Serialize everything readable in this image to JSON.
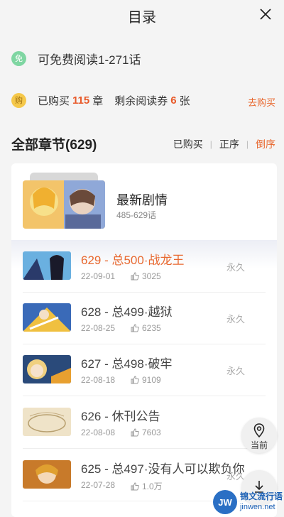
{
  "header": {
    "title": "目录"
  },
  "info": {
    "free": {
      "badge": "免",
      "text": "可免费阅读1-271话"
    },
    "purchased": {
      "badge": "购",
      "prefix": "已购买",
      "count": "115",
      "unit": "章",
      "coupon_prefix": "剩余阅读券",
      "coupon_count": "6",
      "coupon_unit": "张",
      "buy_link": "去购买"
    }
  },
  "section": {
    "title": "全部章节(629)",
    "sort": {
      "purchased": "已购买",
      "order_asc": "正序",
      "order_desc": "倒序"
    }
  },
  "latest": {
    "title": "最新剧情",
    "range": "485-629话"
  },
  "chapters": [
    {
      "title": "629 - 总500·战龙王",
      "date": "22-09-01",
      "likes": "3025",
      "status": "永久",
      "current": true
    },
    {
      "title": "628 - 总499·越狱",
      "date": "22-08-25",
      "likes": "6235",
      "status": "永久"
    },
    {
      "title": "627 - 总498·破牢",
      "date": "22-08-18",
      "likes": "9109",
      "status": "永久"
    },
    {
      "title": "626 - 休刊公告",
      "date": "22-08-08",
      "likes": "7603",
      "status": ""
    },
    {
      "title": "625 - 总497·没有人可以欺负你",
      "date": "22-07-28",
      "likes": "1.0万",
      "status": "永久"
    }
  ],
  "fab": {
    "locate_label": "当前"
  },
  "watermark": {
    "logo": "JW",
    "cn": "锦文流行语",
    "en": "jinwen.net"
  },
  "colors": {
    "accent": "#e8682f",
    "free_badge": "#7fd6a2",
    "buy_badge": "#f5c84a"
  }
}
